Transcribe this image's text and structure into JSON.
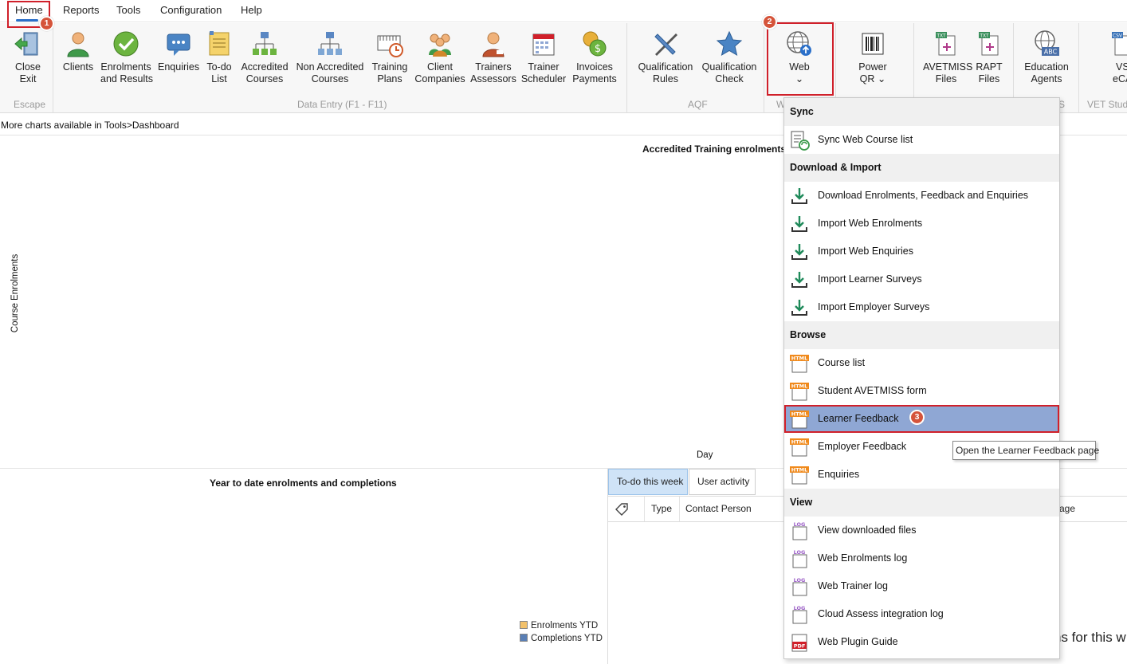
{
  "menu": {
    "home": "Home",
    "reports": "Reports",
    "tools": "Tools",
    "configuration": "Configuration",
    "help": "Help"
  },
  "ribbon": {
    "close_exit": [
      "Close",
      "Exit"
    ],
    "clients": [
      "Clients"
    ],
    "enrolments": [
      "Enrolments",
      "and Results"
    ],
    "enquiries": [
      "Enquiries"
    ],
    "todo": [
      "To-do",
      "List"
    ],
    "accredited": [
      "Accredited",
      "Courses"
    ],
    "nonaccredited": [
      "Non Accredited",
      "Courses"
    ],
    "training": [
      "Training",
      "Plans"
    ],
    "client_companies": [
      "Client",
      "Companies"
    ],
    "trainers": [
      "Trainers",
      "Assessors"
    ],
    "scheduler": [
      "Trainer",
      "Scheduler"
    ],
    "invoices": [
      "Invoices",
      "Payments"
    ],
    "qual_rules": [
      "Qualification",
      "Rules"
    ],
    "qual_check": [
      "Qualification",
      "Check"
    ],
    "web": [
      "Web",
      "⌄"
    ],
    "powerqr": [
      "Power",
      "QR ⌄"
    ],
    "avetmiss": [
      "AVETMISS",
      "Files"
    ],
    "rapt": [
      "RAPT",
      "Files"
    ],
    "education": [
      "Education",
      "Agents"
    ],
    "vs": [
      "VS",
      "eCAF"
    ],
    "groups": {
      "escape": "Escape",
      "data_entry": "Data Entry (F1 - F11)",
      "aqf": "AQF",
      "web_partial": "W",
      "agents_partial": "S",
      "vet_partial": "VET Stude"
    }
  },
  "dashboard": {
    "info": "More charts available in Tools>Dashboard",
    "chart1_title": "Accredited Training enrolments",
    "y_axis": "Course Enrolments",
    "x_axis": "Day",
    "chart2_title": "Year to date enrolments and completions",
    "legend": [
      {
        "label": "Enrolments YTD",
        "color": "#f2c16b"
      },
      {
        "label": "Completions YTD",
        "color": "#5a7fb5"
      }
    ],
    "tabs": {
      "todo": "To-do this week",
      "activity": "User activity"
    },
    "grid_cols": {
      "type": "Type",
      "contact": "Contact Person",
      "page_partial": "age"
    },
    "bottom_text": "ns for this w"
  },
  "web_menu": {
    "sync_header": "Sync",
    "sync_course": "Sync Web Course list",
    "dl_header": "Download & Import",
    "dl_all": "Download Enrolments, Feedback and Enquiries",
    "imp_enrol": "Import Web Enrolments",
    "imp_enq": "Import Web Enquiries",
    "imp_learner": "Import Learner Surveys",
    "imp_employer": "Import Employer Surveys",
    "browse_header": "Browse",
    "course_list": "Course list",
    "avetmiss_form": "Student AVETMISS form",
    "learner_feedback": "Learner Feedback",
    "employer_feedback": "Employer Feedback",
    "enquiries": "Enquiries",
    "view_header": "View",
    "downloaded": "View downloaded files",
    "enrol_log": "Web Enrolments log",
    "trainer_log": "Web Trainer log",
    "cloud_log": "Cloud Assess integration log",
    "plugin_guide": "Web Plugin Guide"
  },
  "tooltip": "Open the Learner Feedback page",
  "badges": {
    "b1": "1",
    "b2": "2",
    "b3": "3"
  }
}
